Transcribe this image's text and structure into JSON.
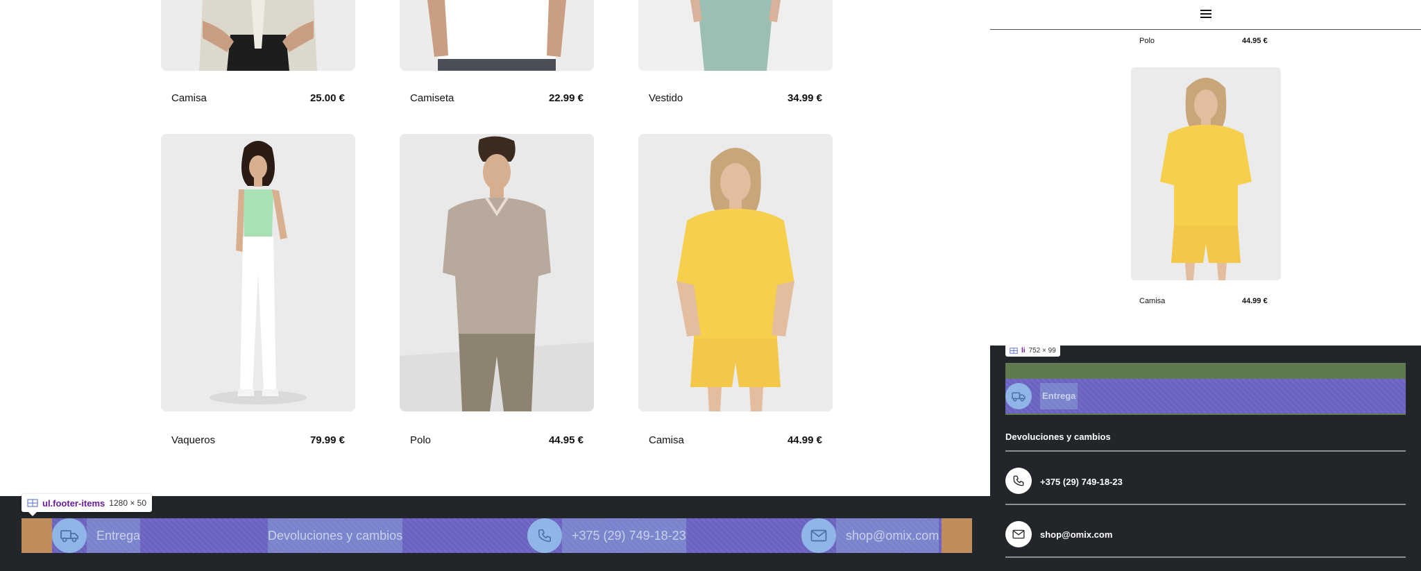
{
  "products_top": [
    {
      "name": "Camisa",
      "price": "25.00 €"
    },
    {
      "name": "Camiseta",
      "price": "22.99 €"
    },
    {
      "name": "Vestido",
      "price": "34.99 €"
    }
  ],
  "products_bottom": [
    {
      "name": "Vaqueros",
      "price": "79.99 €"
    },
    {
      "name": "Polo",
      "price": "44.95 €"
    },
    {
      "name": "Camisa",
      "price": "44.99 €"
    }
  ],
  "desktop_footer": {
    "inspector_tag": "ul.footer-items",
    "inspector_size": "1280 × 50",
    "items": [
      {
        "label": "Entrega",
        "icon": "truck-icon"
      },
      {
        "label": "Devoluciones y cambios",
        "icon": ""
      },
      {
        "label": "+375 (29) 749-18-23",
        "icon": "phone-icon"
      },
      {
        "label": "shop@omix.com",
        "icon": "mail-icon"
      }
    ]
  },
  "mobile": {
    "menu_icon": "hamburger-icon",
    "products": [
      {
        "name": "Polo",
        "price": "44.95 €"
      },
      {
        "name": "Camisa",
        "price": "44.99 €"
      }
    ],
    "inspector_tag": "li",
    "inspector_size": "752 × 99",
    "footer": {
      "delivery": "Entrega",
      "returns": "Devoluciones y cambios",
      "phone": "+375 (29) 749-18-23",
      "email": "shop@omix.com"
    }
  },
  "colors": {
    "footer_bg": "#222529",
    "highlight_purple": "#6b63c0",
    "highlight_orange": "#c08d5a",
    "highlight_green": "#5e7a4e",
    "icon_bubble": "#8fb6e6"
  }
}
